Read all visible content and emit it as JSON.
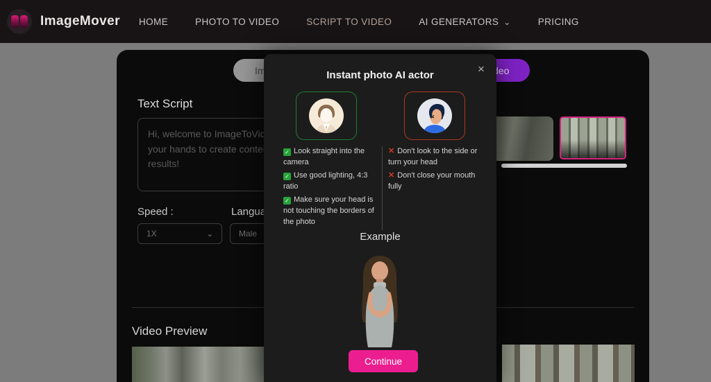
{
  "navbar": {
    "brand": "ImageMover",
    "items": [
      {
        "label": "HOME"
      },
      {
        "label": "PHOTO TO VIDEO"
      },
      {
        "label": "SCRIPT TO VIDEO"
      },
      {
        "label": "AI GENERATORS"
      },
      {
        "label": "PRICING"
      }
    ],
    "chevron": "⌄"
  },
  "page": {
    "tabs": [
      {
        "label": "Image to Video"
      },
      {
        "label": "Script to Video"
      }
    ],
    "text_script": {
      "label": "Text Script",
      "placeholder": "Hi, welcome to ImageToVideo AI!\nyour hands to create content and\nresults!"
    },
    "speed": {
      "label": "Speed :",
      "value": "1X",
      "chevron": "⌄"
    },
    "language": {
      "label": "Language",
      "value": "Male",
      "chevron": "⌄"
    },
    "video_preview_label": "Video Preview"
  },
  "modal": {
    "title": "Instant photo AI actor",
    "close": "×",
    "dos": [
      "Look straight into the camera",
      "Use good lighting, 4:3 ratio",
      "Make sure your head is not touching the borders of the photo"
    ],
    "donts": [
      "Don't look to the side or turn your head",
      "Don't close your mouth fully"
    ],
    "example_label": "Example",
    "continue_label": "Continue"
  },
  "icons": {
    "check": "✓",
    "cross": "✕"
  },
  "colors": {
    "accent_pink": "#EC1E8F",
    "purple_pill": "#7E22C4",
    "good_border": "#1E7E34",
    "bad_border": "#A93A20",
    "selected_thumb_border": "#D5237E"
  }
}
